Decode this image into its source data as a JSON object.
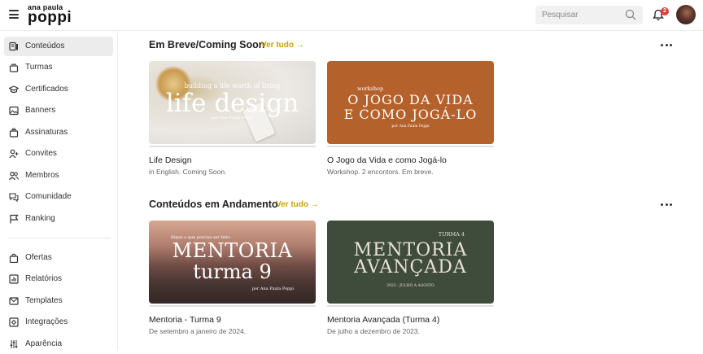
{
  "header": {
    "logo_line1": "ana paula",
    "logo_line2": "poppi",
    "search_placeholder": "Pesquisar",
    "notification_count": "2"
  },
  "sidebar": {
    "items": [
      {
        "label": "Conteúdos",
        "icon": "content-icon",
        "active": true
      },
      {
        "label": "Turmas",
        "icon": "group-icon"
      },
      {
        "label": "Certificados",
        "icon": "certificate-icon"
      },
      {
        "label": "Banners",
        "icon": "image-icon"
      },
      {
        "label": "Assinaturas",
        "icon": "subscription-icon"
      },
      {
        "label": "Convites",
        "icon": "invite-icon"
      },
      {
        "label": "Membros",
        "icon": "members-icon"
      },
      {
        "label": "Comunidade",
        "icon": "chat-icon"
      },
      {
        "label": "Ranking",
        "icon": "flag-icon"
      },
      {
        "label": "Ofertas",
        "icon": "bag-icon"
      },
      {
        "label": "Relatórios",
        "icon": "report-icon"
      },
      {
        "label": "Templates",
        "icon": "mail-icon"
      },
      {
        "label": "Integrações",
        "icon": "integration-icon"
      },
      {
        "label": "Aparência",
        "icon": "sliders-icon"
      }
    ]
  },
  "sections": [
    {
      "title": "Em Breve/Coming Soon",
      "see_all": "Ver tudo →",
      "cards": [
        {
          "title": "Life Design",
          "subtitle": "in English. Coming Soon.",
          "thumb_top": "building a life worth of living",
          "thumb_main": "life design",
          "thumb_bottom": "por Ana Paula Poppi"
        },
        {
          "title": "O Jogo da Vida e como Jogá-lo",
          "subtitle": "Workshop. 2 encontors. Em breve.",
          "thumb_top": "workshop",
          "thumb_main": "O JOGO DA VIDA",
          "thumb_main2": "E COMO JOGÁ-LO",
          "thumb_bottom": "por Ana Paula Poppi"
        }
      ]
    },
    {
      "title": "Conteúdos em Andamento",
      "see_all": "Ver tudo →",
      "cards": [
        {
          "title": "Mentoria - Turma 9",
          "subtitle": "De setembro a janeiro de 2024.",
          "thumb_top": "Rique o que precisa ser feito",
          "thumb_main": "MENTORIA",
          "thumb_main2": "turma 9",
          "thumb_bottom": "por Ana Paula Poppi"
        },
        {
          "title": "Mentoria Avançada (Turma 4)",
          "subtitle": "De julho a dezembro de 2023.",
          "thumb_top": "TURMA 4",
          "thumb_main": "MENTORIA",
          "thumb_main2": "AVANÇADA",
          "thumb_bottom": "2023 - JULHO A AGOSTO"
        }
      ]
    }
  ],
  "colors": {
    "accent": "#c9a400",
    "badge": "#e53935",
    "card_orange": "#b5612b",
    "card_green": "#3f4b3b",
    "card_sunset": "#7a5048"
  }
}
